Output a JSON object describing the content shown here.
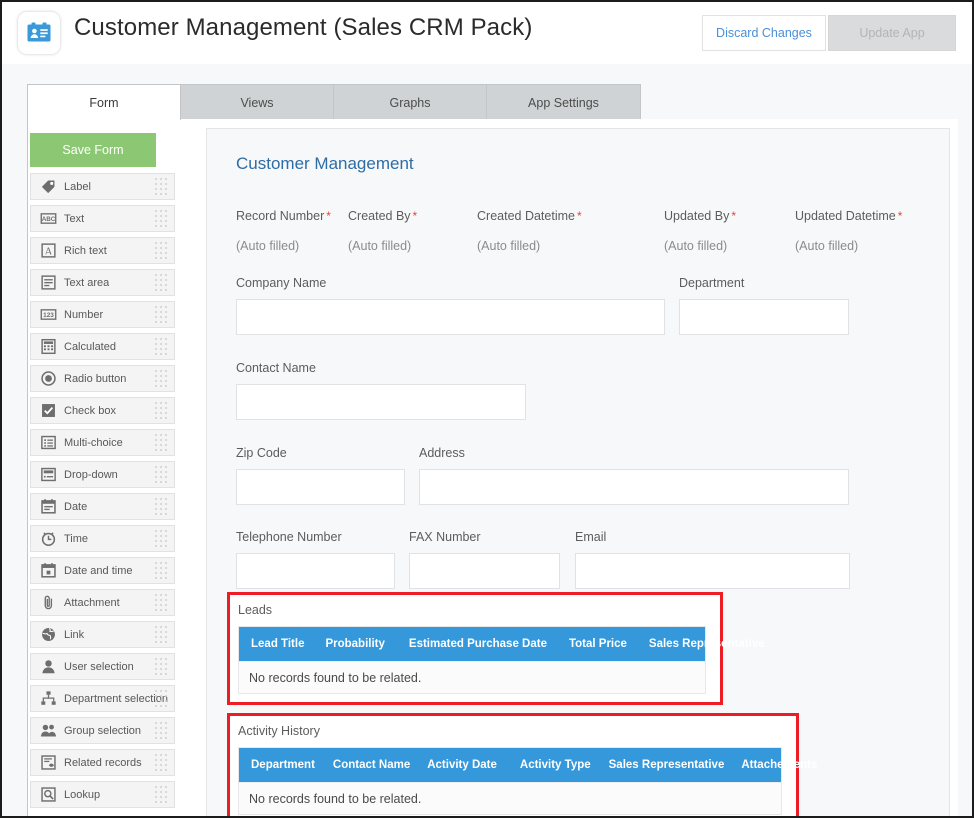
{
  "header": {
    "app_icon": "contact-card-icon",
    "title": "Customer Management (Sales CRM Pack)",
    "discard_label": "Discard Changes",
    "update_label": "Update App"
  },
  "tabs": [
    {
      "label": "Form",
      "active": true
    },
    {
      "label": "Views",
      "active": false
    },
    {
      "label": "Graphs",
      "active": false
    },
    {
      "label": "App Settings",
      "active": false
    }
  ],
  "sidebar": {
    "save_label": "Save Form",
    "items": [
      {
        "label": "Label",
        "icon": "tag-icon"
      },
      {
        "label": "Text",
        "icon": "abc-icon"
      },
      {
        "label": "Rich text",
        "icon": "letter-a-icon"
      },
      {
        "label": "Text area",
        "icon": "text-lines-icon"
      },
      {
        "label": "Number",
        "icon": "123-icon"
      },
      {
        "label": "Calculated",
        "icon": "calculator-icon"
      },
      {
        "label": "Radio button",
        "icon": "radio-button-icon"
      },
      {
        "label": "Check box",
        "icon": "checkbox-icon"
      },
      {
        "label": "Multi-choice",
        "icon": "multi-choice-icon"
      },
      {
        "label": "Drop-down",
        "icon": "dropdown-icon"
      },
      {
        "label": "Date",
        "icon": "calendar-icon"
      },
      {
        "label": "Time",
        "icon": "clock-icon"
      },
      {
        "label": "Date and time",
        "icon": "calendar-clock-icon"
      },
      {
        "label": "Attachment",
        "icon": "paperclip-icon"
      },
      {
        "label": "Link",
        "icon": "globe-icon"
      },
      {
        "label": "User selection",
        "icon": "user-icon"
      },
      {
        "label": "Department selection",
        "icon": "org-chart-icon"
      },
      {
        "label": "Group selection",
        "icon": "users-group-icon"
      },
      {
        "label": "Related records",
        "icon": "related-records-icon"
      },
      {
        "label": "Lookup",
        "icon": "magnifier-box-icon"
      }
    ]
  },
  "form": {
    "title": "Customer Management",
    "autofill_text": "(Auto filled)",
    "system_fields": [
      {
        "label": "Record Number",
        "required": true,
        "value": "(Auto filled)"
      },
      {
        "label": "Created By",
        "required": true,
        "value": "(Auto filled)"
      },
      {
        "label": "Created Datetime",
        "required": true,
        "value": "(Auto filled)"
      },
      {
        "label": "Updated By",
        "required": true,
        "value": "(Auto filled)"
      },
      {
        "label": "Updated Datetime",
        "required": true,
        "value": "(Auto filled)"
      }
    ],
    "fields": [
      {
        "label": "Company Name",
        "value": ""
      },
      {
        "label": "Department",
        "value": ""
      },
      {
        "label": "Contact Name",
        "value": ""
      },
      {
        "label": "Zip Code",
        "value": ""
      },
      {
        "label": "Address",
        "value": ""
      },
      {
        "label": "Telephone Number",
        "value": ""
      },
      {
        "label": "FAX Number",
        "value": ""
      },
      {
        "label": "Email",
        "value": ""
      }
    ],
    "related_tables": [
      {
        "title": "Leads",
        "highlighted": true,
        "columns": [
          "Lead Title",
          "Probability",
          "Estimated Purchase Date",
          "Total Price",
          "Sales Representative"
        ],
        "empty_message": "No records found to be related."
      },
      {
        "title": "Activity History",
        "highlighted": true,
        "columns": [
          "Department",
          "Contact Name",
          "Activity Date",
          "Activity Type",
          "Sales Representative",
          "Attachements"
        ],
        "empty_message": "No records found to be related."
      }
    ]
  },
  "colors": {
    "accent_blue": "#3498db",
    "title_blue": "#2e6da4",
    "save_green": "#8cc873",
    "required_red": "#e8443a",
    "highlight_red": "#ee1c25",
    "link_blue": "#4a90d9"
  }
}
